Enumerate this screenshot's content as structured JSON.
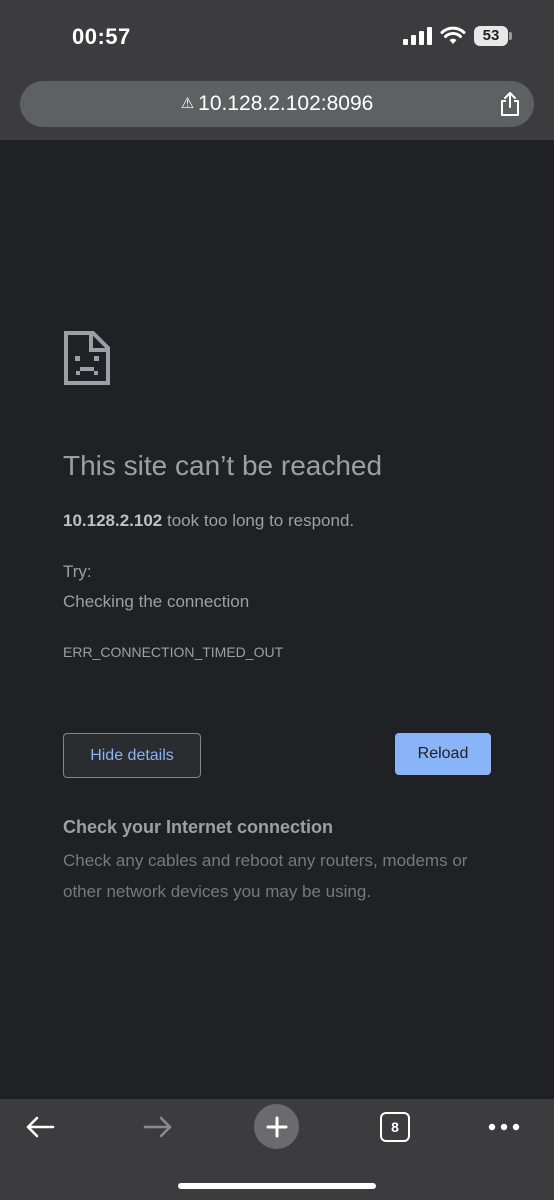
{
  "status_bar": {
    "time": "00:57",
    "battery": "53"
  },
  "address_bar": {
    "url": "10.128.2.102:8096"
  },
  "error_page": {
    "title": "This site can’t be reached",
    "host": "10.128.2.102",
    "message": " took too long to respond.",
    "try_label": "Try:",
    "suggestion": "Checking the connection",
    "error_code": "ERR_CONNECTION_TIMED_OUT",
    "hide_details_label": "Hide details",
    "reload_label": "Reload",
    "check_heading": "Check your Internet connection",
    "check_body": "Check any cables and reboot any routers, modems or other network devices you may be using."
  },
  "toolbar": {
    "tab_count": "8"
  },
  "colors": {
    "background": "#202124",
    "accent": "#8ab4f8",
    "chrome": "#3c3c3e"
  }
}
